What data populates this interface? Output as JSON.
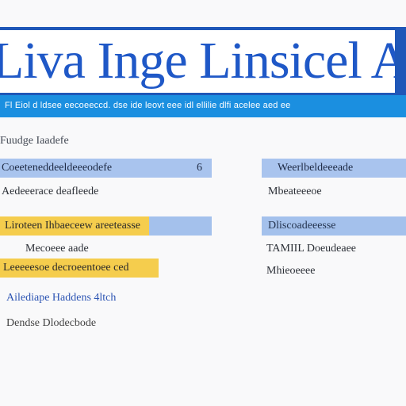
{
  "banner": {
    "title": "Liva Inge Linsicel Ana"
  },
  "subbar": {
    "text": "Fl Eiol d ldsee eecoeeccd. dse ide leovt eee idl ellilie dlfi acelee aed ee"
  },
  "section_label": "Fuudge Iaadefe",
  "left_column": {
    "rows": [
      {
        "text": "Coeeteneddeeldeeeodefe",
        "number": "6"
      },
      {
        "text": "Aedeeerace deafleede",
        "number": ""
      },
      {
        "text": "Liroteen Ihbaeceew areeteasse",
        "number": ""
      },
      {
        "text": "Mecoeee aade",
        "number": ""
      },
      {
        "text": "Leeeeesoe decroeentoee ced",
        "number": ""
      },
      {
        "text": "Ailediape Haddens 4ltch",
        "number": ""
      },
      {
        "text": "Dendse Dlodecbode",
        "number": ""
      }
    ]
  },
  "right_column": {
    "rows": [
      {
        "text": "Weerlbeldeeeade"
      },
      {
        "text": "Mbeateeeoe"
      },
      {
        "text": "Dliscoadeeesse"
      },
      {
        "text": "TAMIIL Doeudeaee"
      },
      {
        "text": "Mhieoeeee"
      }
    ]
  },
  "colors": {
    "banner_border": "#1f57b8",
    "banner_title": "#1f58c7",
    "subbar": "#1b8fe0",
    "highlight_blue": "#a9c4ee",
    "highlight_yellow": "#f5cd4d",
    "link": "#2d55b3"
  }
}
